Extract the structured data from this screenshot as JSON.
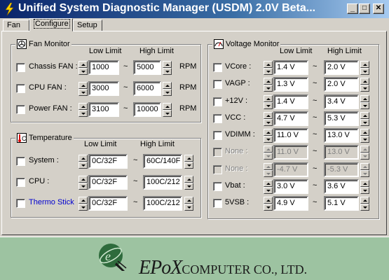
{
  "window": {
    "title": "Unified System Diagnostic Manager (USDM) 2.0V Beta...",
    "minimize": "_",
    "maximize": "□",
    "close": "✕"
  },
  "tabs": [
    "Fan",
    "Configure",
    "Setup"
  ],
  "fan_monitor": {
    "title": "Fan Monitor",
    "low_header": "Low Limit",
    "high_header": "High Limit",
    "rows": [
      {
        "label": "Chassis FAN :",
        "low": "1000",
        "high": "5000",
        "unit": "RPM"
      },
      {
        "label": "CPU FAN :",
        "low": "3000",
        "high": "6000",
        "unit": "RPM"
      },
      {
        "label": "Power FAN :",
        "low": "3100",
        "high": "10000",
        "unit": "RPM"
      }
    ]
  },
  "temperature": {
    "title": "Temperature",
    "low_header": "Low Limit",
    "high_header": "High Limit",
    "rows": [
      {
        "label": "System :",
        "low": "0C/32F",
        "high": "60C/140F"
      },
      {
        "label": "CPU :",
        "low": "0C/32F",
        "high": "100C/212"
      },
      {
        "label": "Thermo Stick",
        "low": "0C/32F",
        "high": "100C/212",
        "color": "#0000d0"
      }
    ]
  },
  "voltage_monitor": {
    "title": "Voltage Monitor",
    "low_header": "Low Limit",
    "high_header": "High Limit",
    "rows": [
      {
        "label": "VCore :",
        "low": "1.4 V",
        "high": "2.0 V",
        "enabled": true
      },
      {
        "label": "VAGP :",
        "low": "1.3 V",
        "high": "2.0 V",
        "enabled": true
      },
      {
        "label": "+12V :",
        "low": "1.4 V",
        "high": "3.4 V",
        "enabled": true
      },
      {
        "label": "VCC :",
        "low": "4.7 V",
        "high": "5.3 V",
        "enabled": true
      },
      {
        "label": "VDIMM :",
        "low": "11.0 V",
        "high": "13.0 V",
        "enabled": true
      },
      {
        "label": "None :",
        "low": "11.0 V",
        "high": "13.0 V",
        "enabled": false
      },
      {
        "label": "None :",
        "low": "-4.7 V",
        "high": "-5.3 V",
        "enabled": false
      },
      {
        "label": "Vbat :",
        "low": "3.0 V",
        "high": "3.6 V",
        "enabled": true
      },
      {
        "label": "5VSB :",
        "low": "4.9 V",
        "high": "5.1 V",
        "enabled": true
      }
    ]
  },
  "separator": "~",
  "footer": {
    "brand": "EPoX",
    "company": "COMPUTER CO., LTD.",
    "background": "#9dc3a1"
  },
  "colors": {
    "title_gradient_start": "#0a246a",
    "title_gradient_end": "#a6caf0",
    "face": "#d4d0c8"
  }
}
